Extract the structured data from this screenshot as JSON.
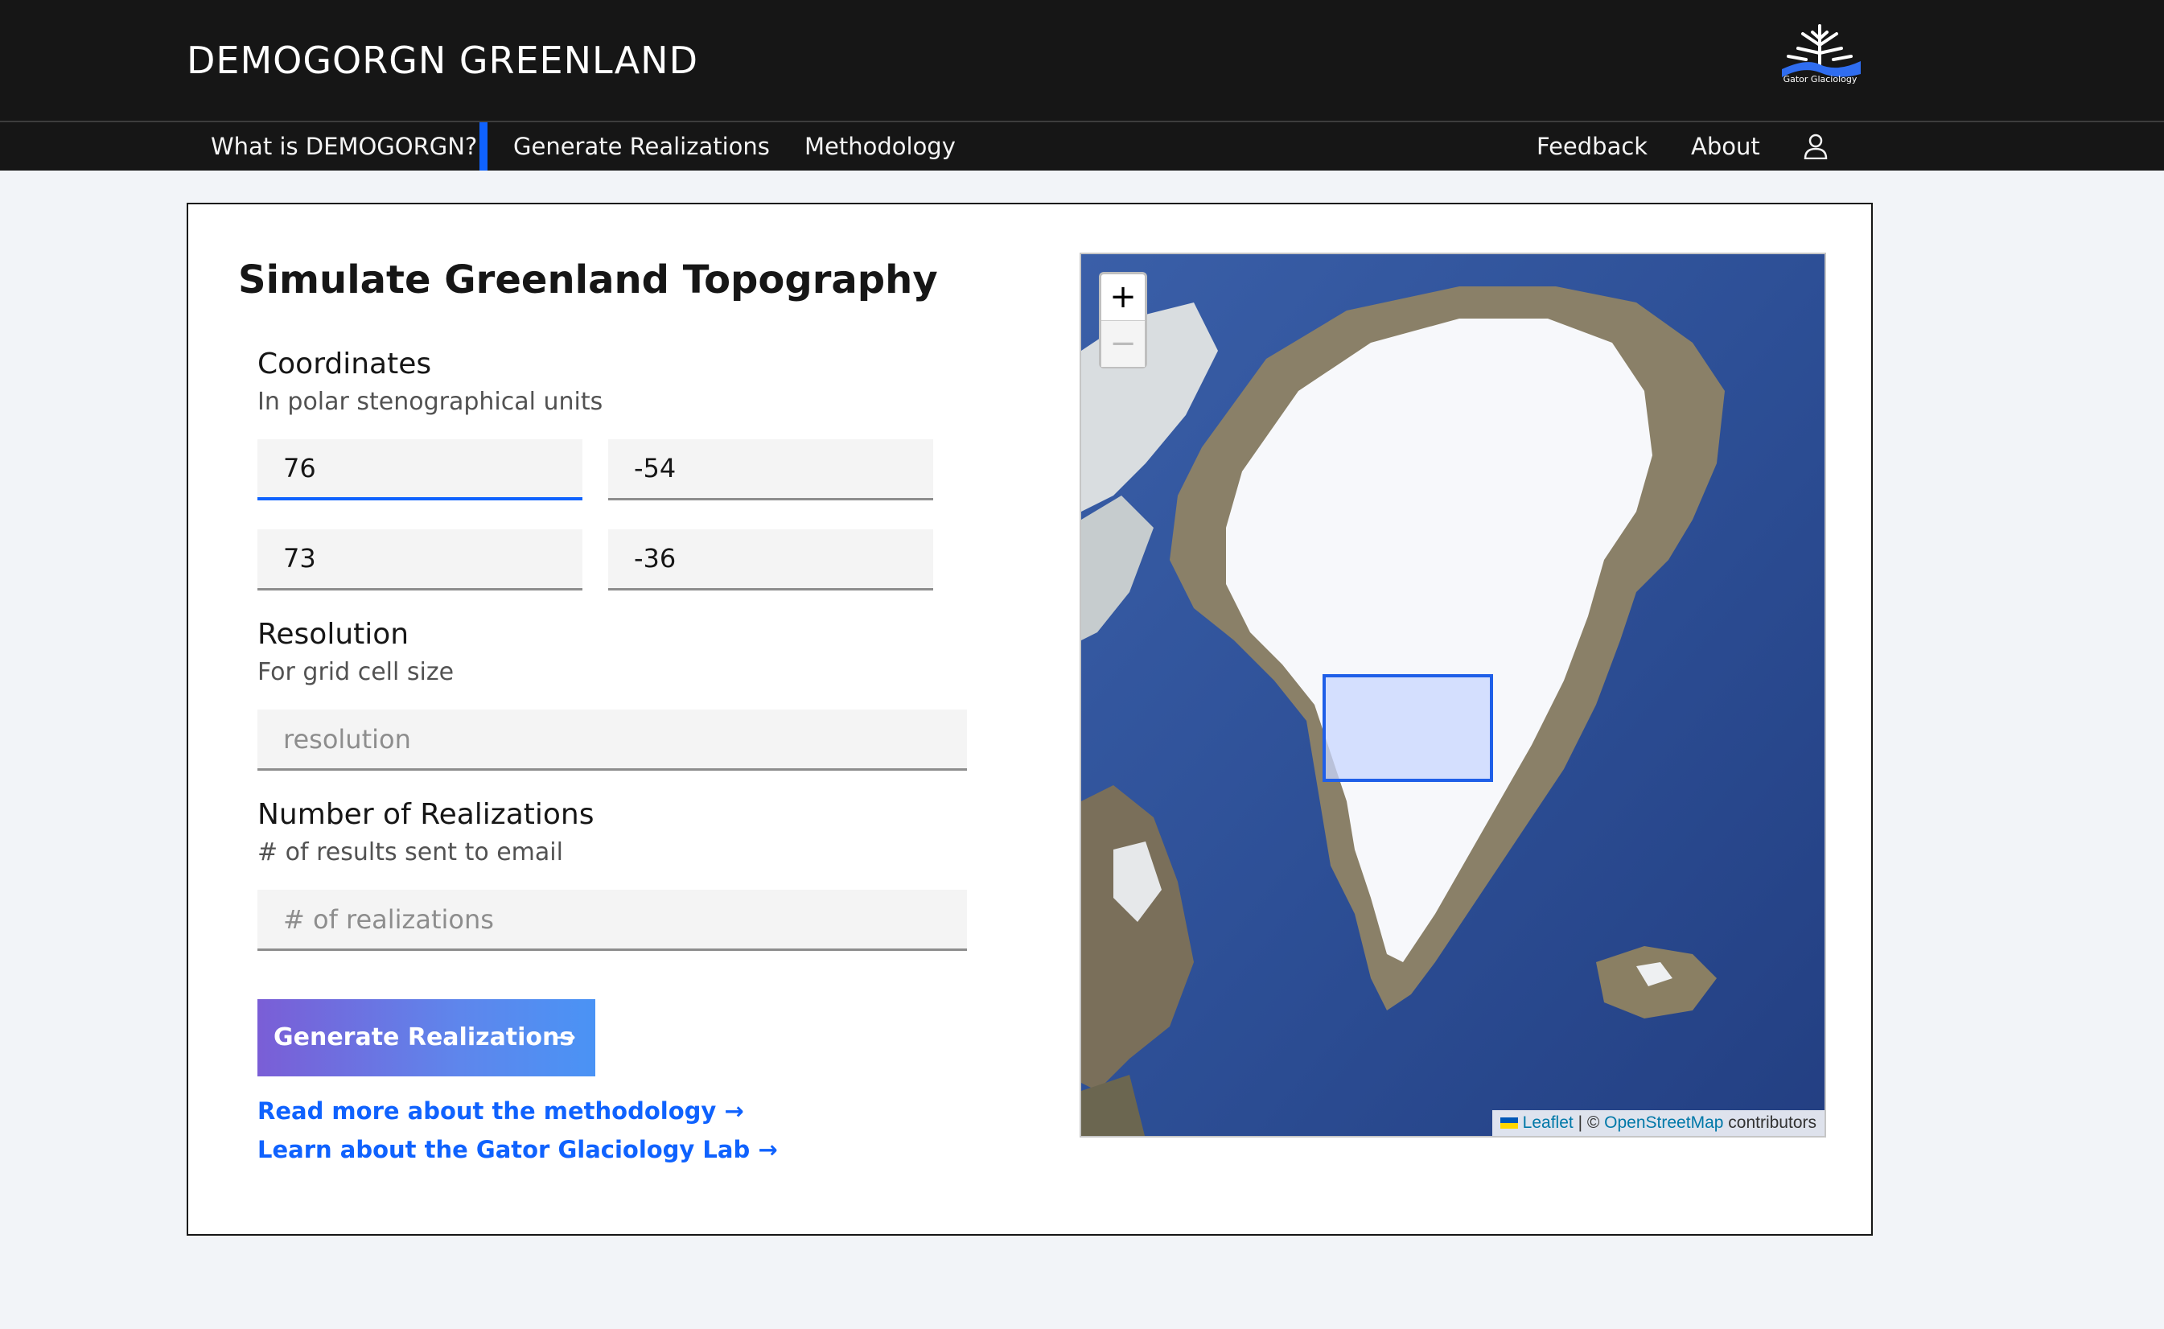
{
  "header": {
    "title": "DEMOGORGN GREENLAND",
    "logo_text": "Gator Glaciology"
  },
  "nav": {
    "left_items": [
      "What is DEMOGORGN?",
      "Generate Realizations",
      "Methodology"
    ],
    "right_items": [
      "Feedback",
      "About"
    ],
    "active_item": "Generate Realizations",
    "user_icon": "user-icon"
  },
  "form": {
    "title": "Simulate Greenland Topography",
    "coordinates": {
      "label": "Coordinates",
      "help": "In polar stenographical units",
      "values": [
        "76",
        "-54",
        "73",
        "-36"
      ]
    },
    "resolution": {
      "label": "Resolution",
      "help": "For grid cell size",
      "placeholder": "resolution",
      "value": ""
    },
    "realizations": {
      "label": "Number of Realizations",
      "help": "# of results sent to email",
      "placeholder": "# of realizations",
      "value": ""
    },
    "submit_label": "Generate Realizations",
    "submit_arrow": "→",
    "links": [
      "Read more about the methodology →",
      "Learn about the Gator Glaciology Lab →"
    ]
  },
  "map": {
    "zoom_in": "+",
    "zoom_out": "−",
    "attribution": {
      "leaflet": "Leaflet",
      "separator": "| ©",
      "osm": "OpenStreetMap",
      "suffix": "contributors"
    },
    "selection_color": "#1f5fe8"
  },
  "colors": {
    "accent": "#0f62fe",
    "header_bg": "#161616",
    "page_bg": "#f2f4f8"
  }
}
